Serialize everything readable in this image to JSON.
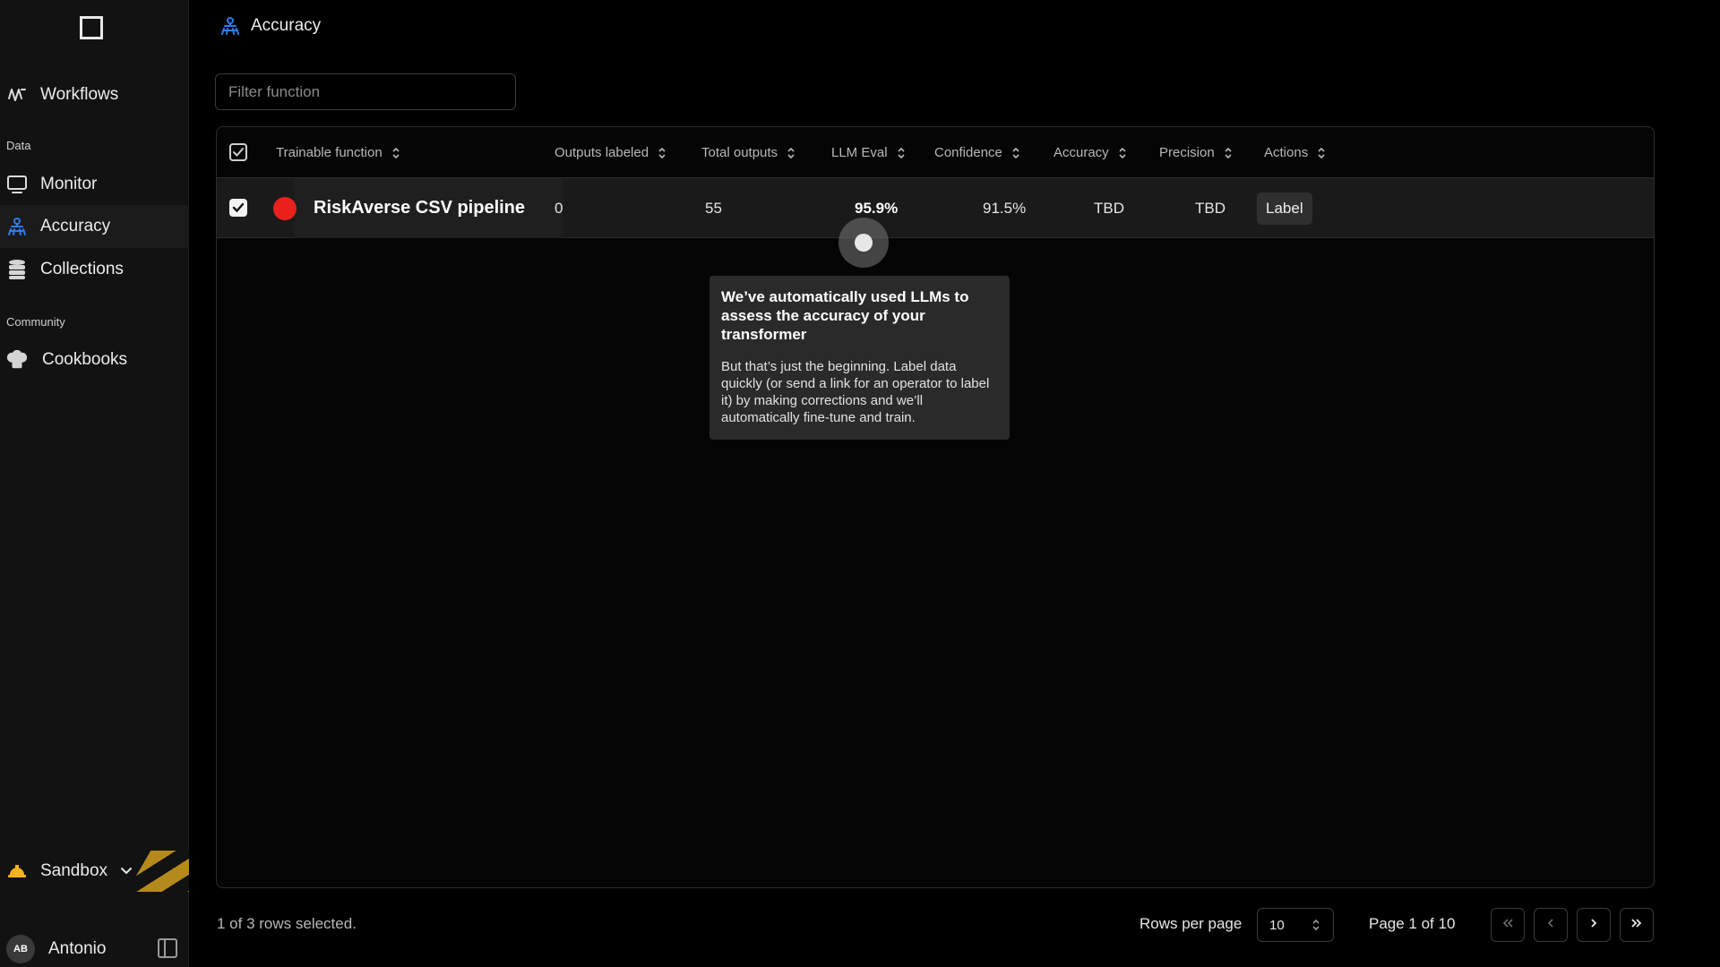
{
  "sidebar": {
    "workflows_label": "Workflows",
    "data_section": "Data",
    "monitor_label": "Monitor",
    "accuracy_label": "Accuracy",
    "collections_label": "Collections",
    "community_section": "Community",
    "cookbooks_label": "Cookbooks",
    "sandbox_label": "Sandbox",
    "user_initials": "AB",
    "user_name": "Antonio"
  },
  "header": {
    "title": "Accuracy"
  },
  "filter": {
    "placeholder": "Filter function"
  },
  "table": {
    "columns": {
      "trainable_function": "Trainable function",
      "outputs_labeled": "Outputs labeled",
      "total_outputs": "Total outputs",
      "llm_eval": "LLM Eval",
      "confidence": "Confidence",
      "accuracy": "Accuracy",
      "precision": "Precision",
      "actions": "Actions"
    },
    "rows": [
      {
        "name": "RiskAverse CSV pipeline",
        "outputs_labeled": "0",
        "total_outputs": "55",
        "llm_eval": "95.9%",
        "confidence": "91.5%",
        "accuracy": "TBD",
        "precision": "TBD",
        "action_label": "Label",
        "checked": true
      }
    ]
  },
  "tooltip": {
    "title": "We’ve automatically used LLMs to assess the accuracy of your transformer",
    "body": "But that’s just the beginning. Label data quickly (or send a link for an operator to label it) by making corrections and we’ll automatically fine-tune and train."
  },
  "footer": {
    "selected_text": "1 of 3 rows selected.",
    "rows_per_page_label": "Rows per page",
    "rows_per_page_value": "10",
    "page_info": "Page 1 of 10"
  },
  "colors": {
    "accent_blue": "#2b7de9",
    "status_red": "#e8211c",
    "sandbox_yellow": "#f2b31b"
  }
}
